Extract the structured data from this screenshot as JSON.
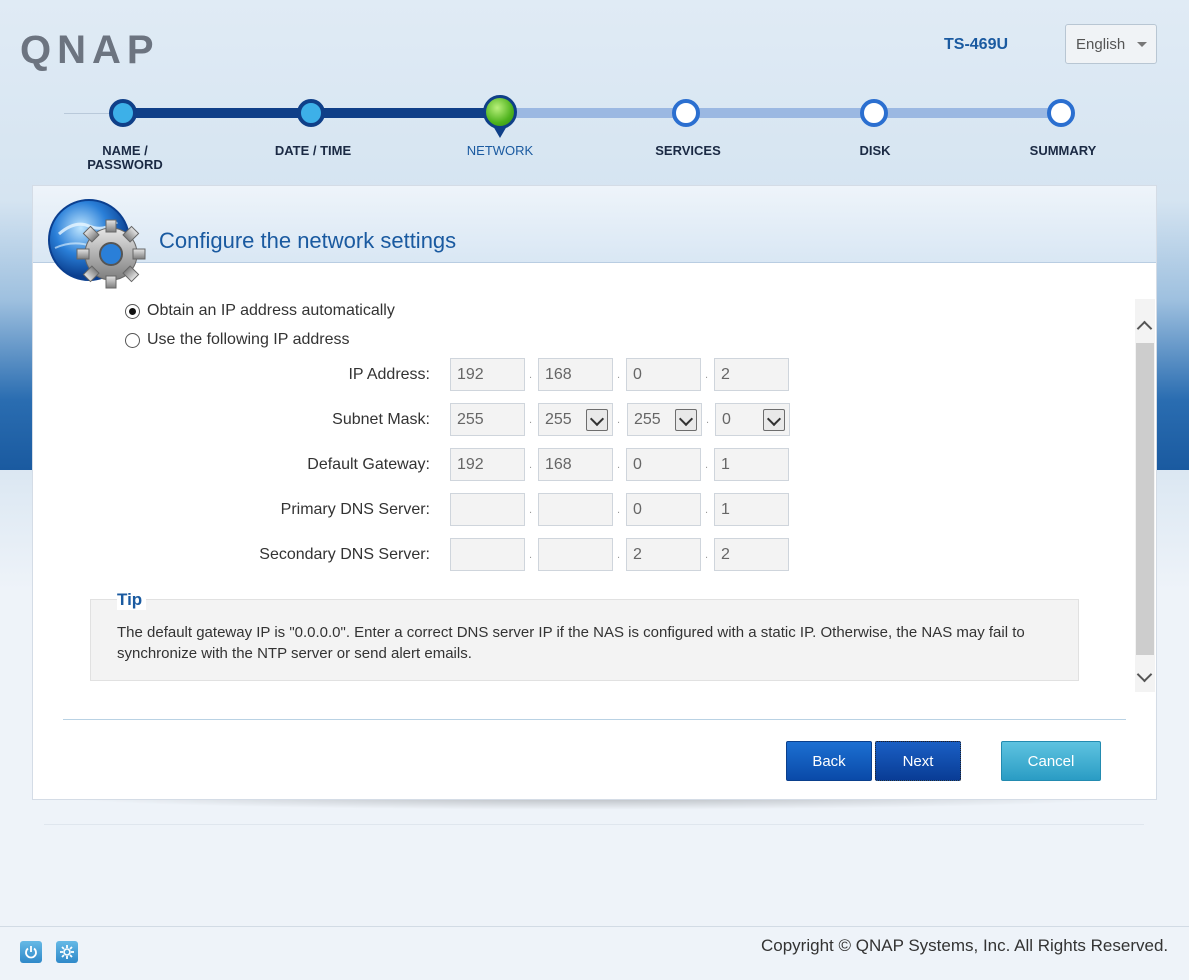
{
  "header": {
    "brand": "QNAP",
    "model": "TS-469U",
    "language": "English"
  },
  "steps": [
    {
      "label": "NAME /\nPASSWORD",
      "state": "done"
    },
    {
      "label": "DATE / TIME",
      "state": "done"
    },
    {
      "label": "NETWORK",
      "state": "current"
    },
    {
      "label": "SERVICES",
      "state": "todo"
    },
    {
      "label": "DISK",
      "state": "todo"
    },
    {
      "label": "SUMMARY",
      "state": "todo"
    }
  ],
  "panel": {
    "title": "Configure the network settings"
  },
  "form": {
    "radio_auto": "Obtain an IP address automatically",
    "radio_manual": "Use the following IP address",
    "selected": "auto",
    "fields": {
      "ip": {
        "label": "IP Address:",
        "octets": [
          "192",
          "168",
          "0",
          "2"
        ]
      },
      "subnet": {
        "label": "Subnet Mask:",
        "octets": [
          "255",
          "255",
          "255",
          "0"
        ]
      },
      "gateway": {
        "label": "Default Gateway:",
        "octets": [
          "192",
          "168",
          "0",
          "1"
        ]
      },
      "dns1": {
        "label": "Primary DNS Server:",
        "octets": [
          "",
          "",
          "0",
          "1"
        ]
      },
      "dns2": {
        "label": "Secondary DNS Server:",
        "octets": [
          "",
          "",
          "2",
          "2"
        ]
      }
    }
  },
  "tip": {
    "title": "Tip",
    "text": "The default gateway IP is \"0.0.0.0\". Enter a correct DNS server IP if the NAS is configured with a static IP. Otherwise, the NAS may fail to synchronize with the NTP server or send alert emails."
  },
  "buttons": {
    "back": "Back",
    "next": "Next",
    "cancel": "Cancel"
  },
  "footer": {
    "copyright": "Copyright © QNAP Systems, Inc. All Rights Reserved."
  },
  "colors": {
    "accent": "#1a5aa0",
    "step_done": "#0f3f88",
    "step_current": "#4fb31e"
  }
}
